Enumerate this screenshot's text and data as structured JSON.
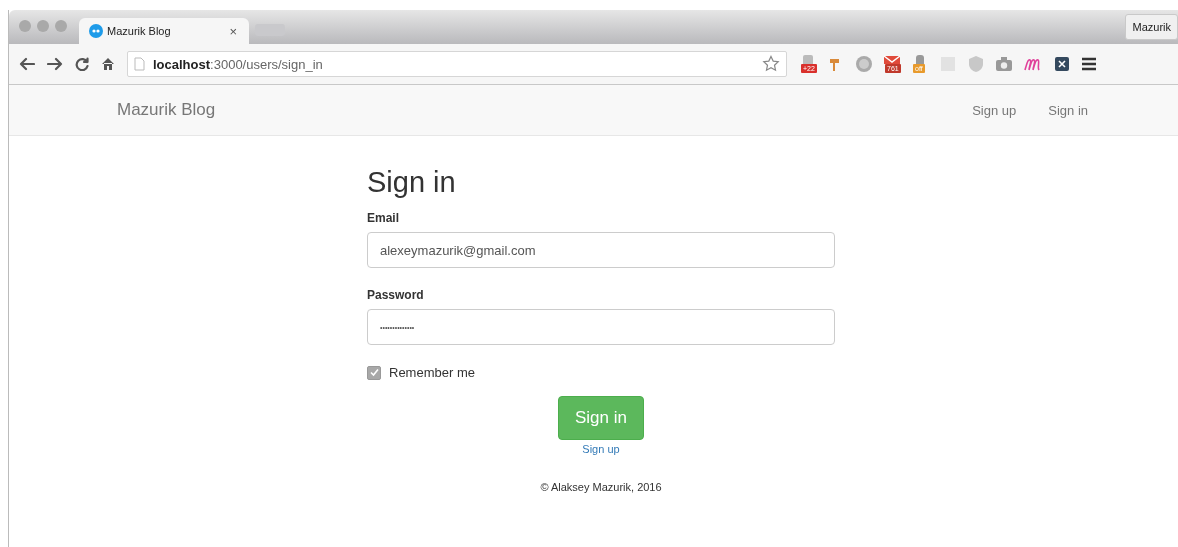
{
  "browser": {
    "tabs": [
      {
        "title": "Mazurik Blog",
        "close": "×",
        "selected": true
      }
    ],
    "profile": "Mazurik",
    "address": {
      "host": "localhost",
      "path": ":3000/users/sign_in"
    },
    "extension_badges": [
      "+22",
      "761",
      "off"
    ]
  },
  "navbar": {
    "brand": "Mazurik Blog",
    "links": [
      "Sign up",
      "Sign in"
    ]
  },
  "form": {
    "title": "Sign in",
    "fields": [
      {
        "label": "Email",
        "value": "alexeymazurik@gmail.com"
      },
      {
        "label": "Password",
        "value": "••••••••••••••"
      }
    ],
    "remember": {
      "label": "Remember me",
      "checked": true
    },
    "submit": "Sign in",
    "link": "Sign up"
  },
  "footer": "© Alaksey Mazurik, 2016"
}
